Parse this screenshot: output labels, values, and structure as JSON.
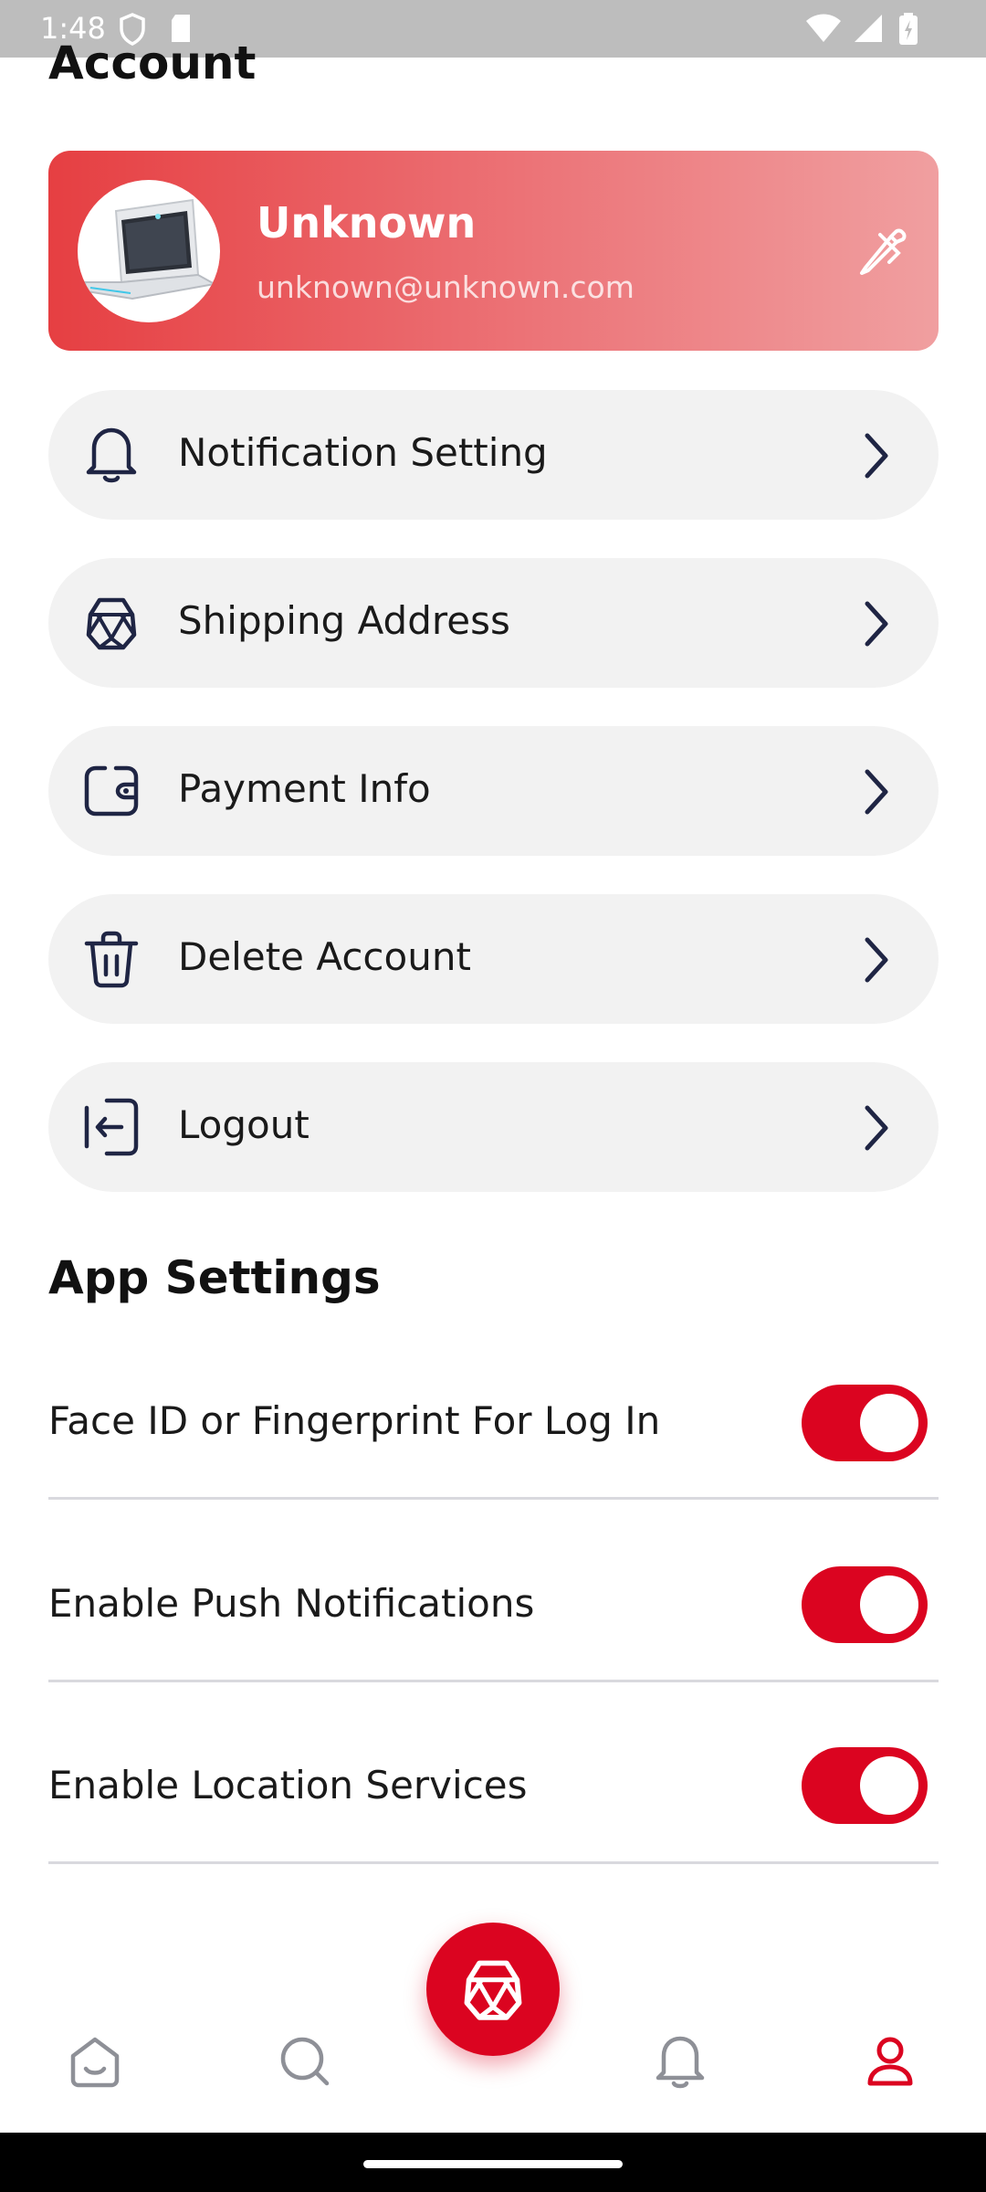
{
  "status_bar": {
    "time": "1:48"
  },
  "account": {
    "title": "Account",
    "profile": {
      "name": "Unknown",
      "email": "unknown@unknown.com"
    },
    "menu": [
      {
        "label": "Notification Setting",
        "icon": "bell-icon"
      },
      {
        "label": "Shipping Address",
        "icon": "basket-icon"
      },
      {
        "label": "Payment Info",
        "icon": "wallet-icon"
      },
      {
        "label": "Delete Account",
        "icon": "trash-icon"
      },
      {
        "label": "Logout",
        "icon": "logout-icon"
      }
    ]
  },
  "app_settings": {
    "title": "App Settings",
    "items": [
      {
        "label": "Face ID or Fingerprint For Log In",
        "enabled": true
      },
      {
        "label": "Enable Push Notifications",
        "enabled": true
      },
      {
        "label": "Enable Location Services",
        "enabled": true
      }
    ]
  },
  "bottom_nav": {
    "items": [
      "home-icon",
      "search-icon",
      "basket-icon",
      "bell-icon",
      "profile-icon"
    ],
    "active": "profile-icon"
  },
  "colors": {
    "accent": "#db0420",
    "card_gradient_start": "#e63f42",
    "card_gradient_end": "#f09fa0",
    "menu_bg": "#f2f2f2",
    "icon_navy": "#1f2544"
  }
}
